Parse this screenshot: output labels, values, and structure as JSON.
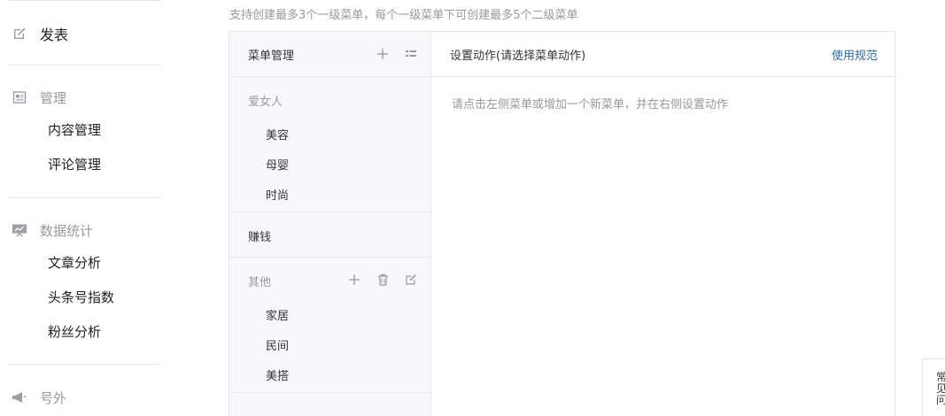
{
  "sidebar": {
    "publish": {
      "label": "发表",
      "icon": "edit-icon"
    },
    "manage": {
      "label": "管理",
      "icon": "document-icon",
      "items": [
        "内容管理",
        "评论管理"
      ]
    },
    "stats": {
      "label": "数据统计",
      "icon": "presentation-icon",
      "items": [
        "文章分析",
        "头条号指数",
        "粉丝分析"
      ]
    },
    "extra": {
      "label": "号外",
      "icon": "megaphone-icon"
    }
  },
  "main": {
    "hint": "支持创建最多3个一级菜单，每个一级菜单下可创建最多5个二级菜单",
    "menu_panel": {
      "title": "菜单管理",
      "groups": [
        {
          "title": "爱女人",
          "items": [
            "美容",
            "母婴",
            "时尚"
          ]
        },
        {
          "title": "赚钱",
          "items": []
        },
        {
          "title": "其他",
          "items": [
            "家居",
            "民间",
            "美搭"
          ]
        }
      ]
    },
    "action_panel": {
      "title": "设置动作(请选择菜单动作)",
      "link": "使用规范",
      "hint": "请点击左侧菜单或增加一个新菜单，并在右侧设置动作"
    }
  },
  "float_tab": {
    "label": "常见问"
  },
  "colors": {
    "link": "#2a6bb5",
    "muted": "#999999",
    "panel_bg": "#f7f8fa",
    "border": "#e8e8e8"
  }
}
